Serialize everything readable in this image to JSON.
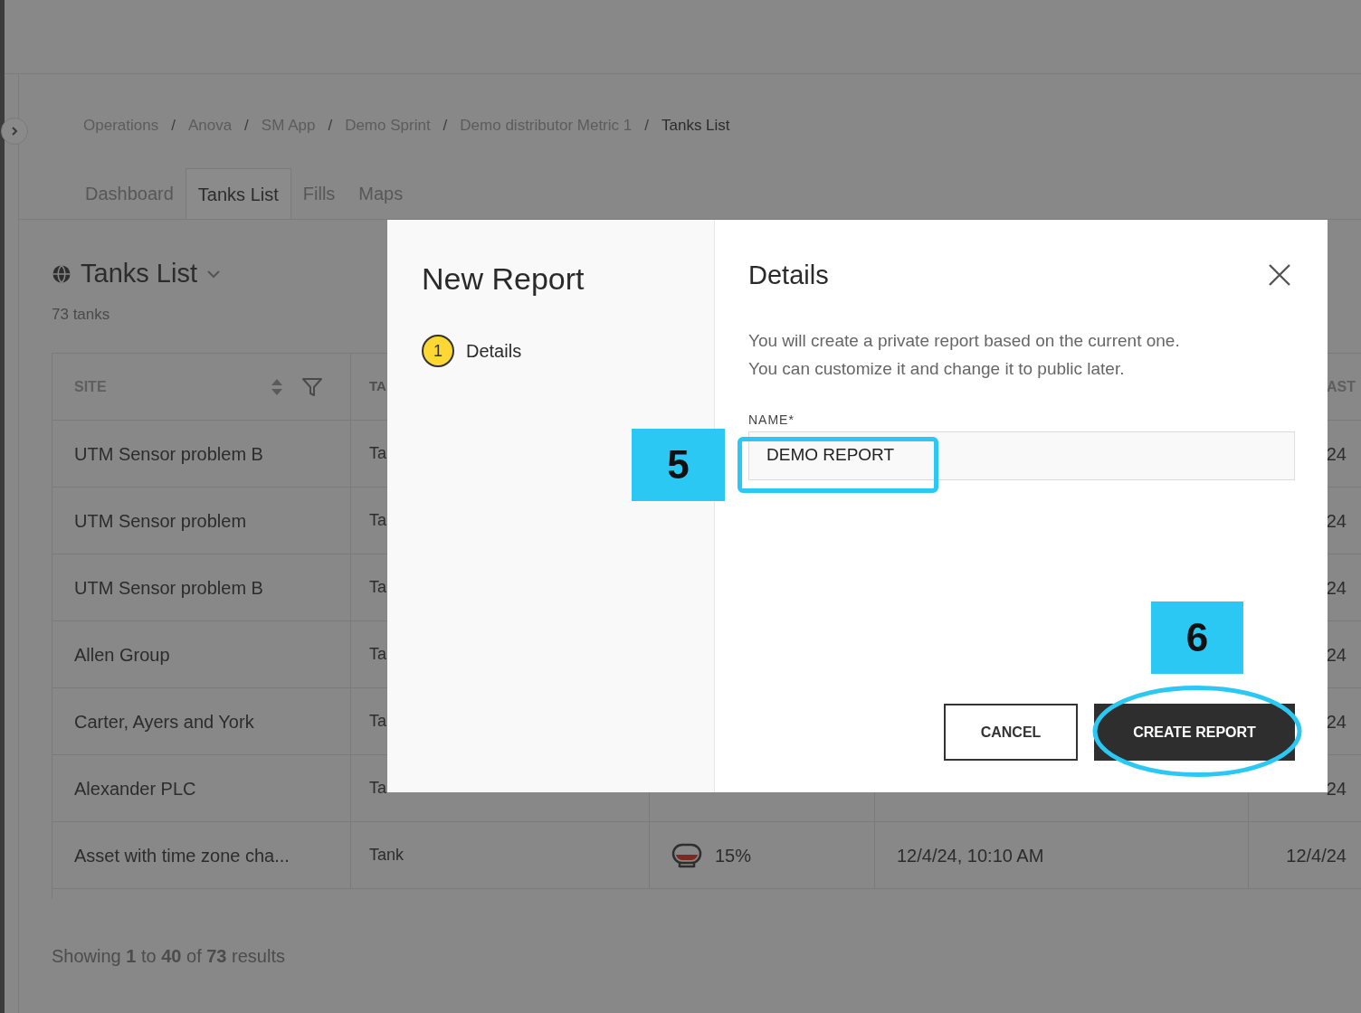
{
  "breadcrumbs": [
    {
      "label": "Operations",
      "current": false
    },
    {
      "separator": "/",
      "label": "Anova",
      "current": false
    },
    {
      "separator": "/",
      "label": "SM App",
      "current": false
    },
    {
      "separator": "/",
      "label": "Demo Sprint",
      "current": false
    },
    {
      "separator": "/",
      "label": "Demo distributor Metric 1",
      "current": false
    },
    {
      "separator": "/",
      "label": "Tanks List",
      "current": true
    }
  ],
  "tabs": [
    {
      "label": "Dashboard",
      "selected": false
    },
    {
      "label": "Tanks List",
      "selected": true
    },
    {
      "label": "Fills",
      "selected": false
    },
    {
      "label": "Maps",
      "selected": false
    }
  ],
  "list": {
    "title": "Tanks List",
    "count": "73 tanks"
  },
  "table": {
    "columns": [
      "SITE",
      "TA",
      "AST"
    ],
    "rows": [
      {
        "site": "UTM Sensor problem B",
        "type": "Ta",
        "last": "24"
      },
      {
        "site": "UTM Sensor problem",
        "type": "Ta",
        "last": "24"
      },
      {
        "site": "UTM Sensor problem B",
        "type": "Ta",
        "last": "24"
      },
      {
        "site": "Allen Group",
        "type": "Ta",
        "last": "24"
      },
      {
        "site": "Carter, Ayers and York",
        "type": "Ta",
        "last": "24"
      },
      {
        "site": "Alexander PLC",
        "type": "Ta",
        "last": "24"
      },
      {
        "site": "Asset with time zone cha...",
        "type": "Tank",
        "reading": "15%",
        "date": "12/4/24, 10:10 AM",
        "last": "12/4/24"
      }
    ]
  },
  "footer": "Showing **1** to **40** of **73** results",
  "modal": {
    "title": "New Report",
    "steps": [
      {
        "number": "1",
        "label": "Details",
        "selected": true
      }
    ],
    "heading": "Details",
    "description": [
      "You will create a private report based on the current one.",
      "You can customize it and change it to public later."
    ],
    "field": {
      "label": "NAME*",
      "value": "DEMO REPORT"
    },
    "cancel": "CANCEL",
    "create": "CREATE REPORT"
  },
  "annotations": [
    {
      "number": "5"
    },
    {
      "number": "6"
    }
  ]
}
